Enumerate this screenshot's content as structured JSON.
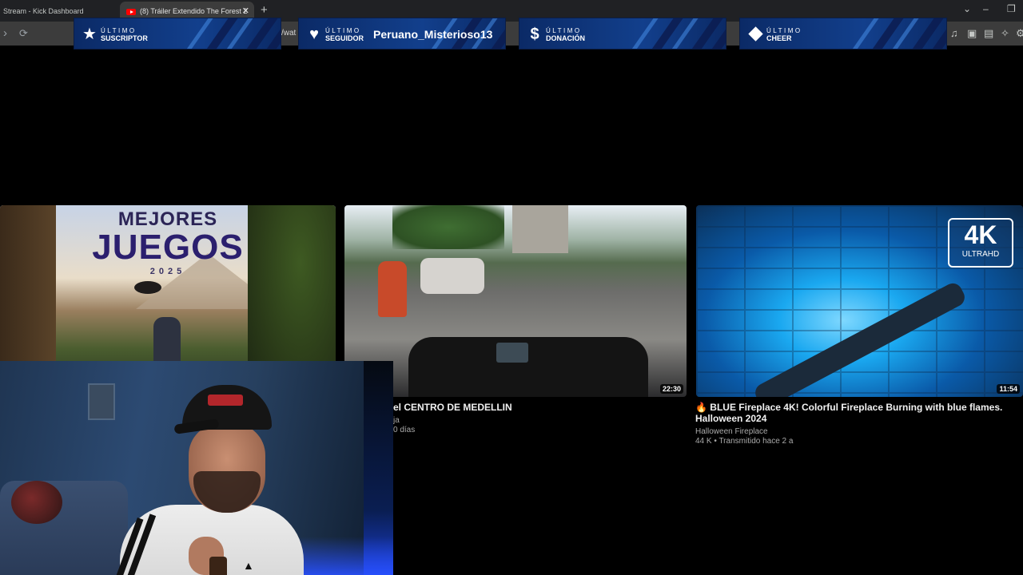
{
  "browser": {
    "tabs": [
      {
        "label": "Stream - Kick Dashboard"
      },
      {
        "label": "(8) Tráiler Extendido The Forest 2"
      }
    ],
    "url_fragment": "/wat"
  },
  "alerts": [
    {
      "title": "ÚLTIMO",
      "subtitle": "SUSCRIPTOR",
      "name": "",
      "icon": "star-icon"
    },
    {
      "title": "ÚLTIMO",
      "subtitle": "SEGUIDOR",
      "name": "Peruano_Misterioso13",
      "icon": "heart-icon"
    },
    {
      "title": "ÚLTIMO",
      "subtitle": "DONACIÓN",
      "name": "",
      "icon": "dollar-icon"
    },
    {
      "title": "ÚLTIMO",
      "subtitle": "CHEER",
      "name": "",
      "icon": "diamond-icon"
    }
  ],
  "videos": [
    {
      "thumb_text": {
        "line1": "MEJORES",
        "line2": "JUEGOS",
        "line3": "2025"
      }
    },
    {
      "duration": "22:30",
      "title": "el CENTRO DE MEDELLIN",
      "channel": "ja",
      "meta": "0 días"
    },
    {
      "duration": "11:54",
      "badge": {
        "big": "4K",
        "small": "ULTRAHD"
      },
      "title": "🔥 BLUE Fireplace 4K! Colorful Fireplace Burning with blue flames. Halloween 2024",
      "channel": "Halloween Fireplace",
      "meta": "44 K • Transmitido hace 2 a"
    }
  ],
  "colors": {
    "banner_blue": "#123f8c",
    "chrome_dark": "#202124",
    "chrome_toolbar": "#3c3c3c"
  }
}
